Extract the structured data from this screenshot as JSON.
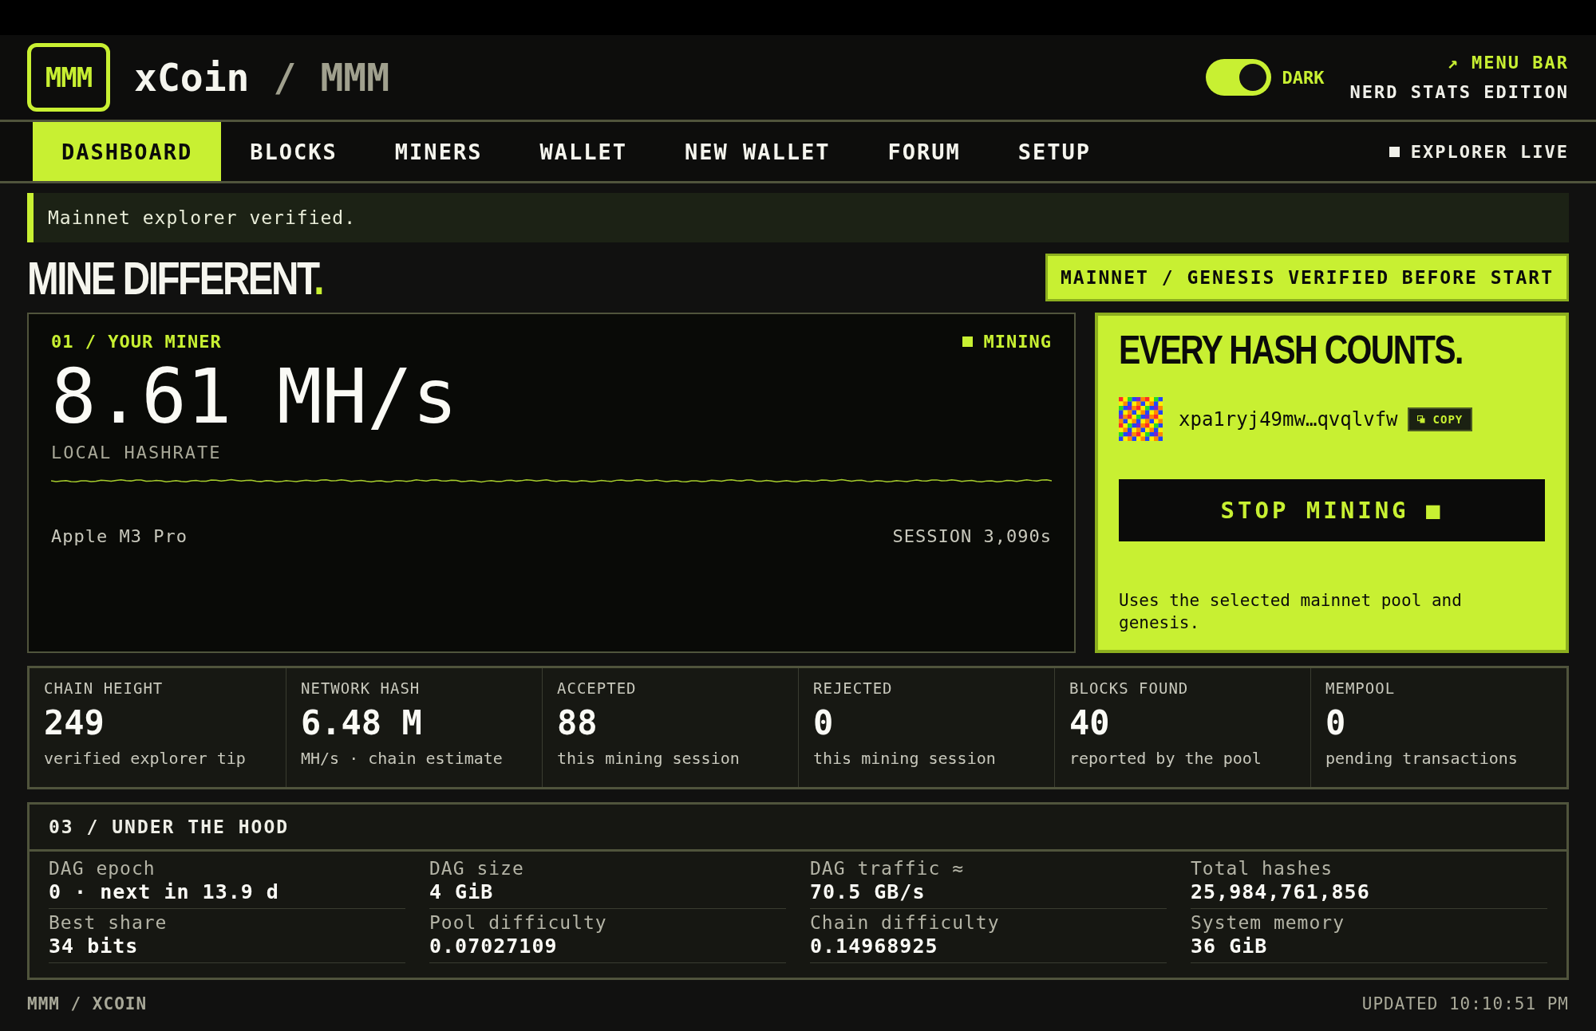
{
  "header": {
    "logo": "MMM",
    "title": "xCoin",
    "separator": "/",
    "subtitle": "MMM",
    "dark_toggle": {
      "label": "DARK",
      "on": true
    },
    "menu_bar_link": "↗ MENU BAR",
    "edition": "NERD STATS EDITION"
  },
  "tabs": [
    {
      "label": "DASHBOARD",
      "selected": true
    },
    {
      "label": "BLOCKS",
      "selected": false
    },
    {
      "label": "MINERS",
      "selected": false
    },
    {
      "label": "WALLET",
      "selected": false
    },
    {
      "label": "NEW WALLET",
      "selected": false
    },
    {
      "label": "FORUM",
      "selected": false
    },
    {
      "label": "SETUP",
      "selected": false
    }
  ],
  "explorer_status": "EXPLORER LIVE",
  "alert": "Mainnet explorer verified.",
  "headline": "MINE DIFFERENT",
  "headline_dot": ".",
  "network_badge": "MAINNET / GENESIS VERIFIED BEFORE START",
  "miner": {
    "section": "01 / YOUR MINER",
    "status": "MINING",
    "hashrate": "8.61 MH/s",
    "hashrate_label": "LOCAL HASHRATE",
    "device": "Apple M3 Pro",
    "session": "SESSION 3,090s"
  },
  "action_card": {
    "title": "EVERY HASH COUNTS.",
    "address": "xpa1ryj49mw…qvqlvfw",
    "copy_button": "COPY",
    "stop_button": "STOP MINING ■",
    "note": "Uses the selected mainnet pool and genesis."
  },
  "stats": [
    {
      "label": "CHAIN HEIGHT",
      "value": "249",
      "detail": "verified explorer tip"
    },
    {
      "label": "NETWORK HASH",
      "value": "6.48 M",
      "detail": "MH/s · chain estimate"
    },
    {
      "label": "ACCEPTED",
      "value": "88",
      "detail": "this mining session"
    },
    {
      "label": "REJECTED",
      "value": "0",
      "detail": "this mining session"
    },
    {
      "label": "BLOCKS FOUND",
      "value": "40",
      "detail": "reported by the pool"
    },
    {
      "label": "MEMPOOL",
      "value": "0",
      "detail": "pending transactions"
    }
  ],
  "under_the_hood": {
    "title": "03 / UNDER THE HOOD",
    "items": [
      {
        "label": "DAG epoch",
        "value": "0 · next in 13.9 d"
      },
      {
        "label": "DAG size",
        "value": "4 GiB"
      },
      {
        "label": "DAG traffic ≈",
        "value": "70.5 GB/s"
      },
      {
        "label": "Total hashes",
        "value": "25,984,761,856"
      },
      {
        "label": "Best share",
        "value": "34 bits"
      },
      {
        "label": "Pool difficulty",
        "value": "0.07027109"
      },
      {
        "label": "Chain difficulty",
        "value": "0.14968925"
      },
      {
        "label": "System memory",
        "value": "36 GiB"
      }
    ]
  },
  "footer": {
    "brand": "MMM / XCOIN",
    "updated": "UPDATED 10:10:51 PM"
  }
}
